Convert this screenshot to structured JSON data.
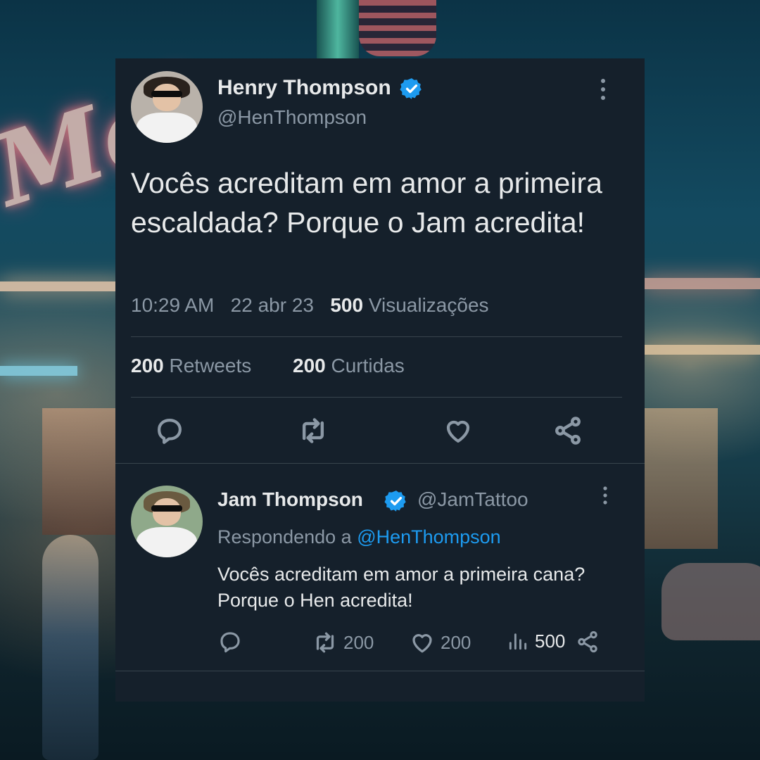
{
  "colors": {
    "card_bg": "#15202b",
    "text": "#e7e9ea",
    "muted": "#8b98a5",
    "link": "#1d9bf0",
    "divider": "#38444d"
  },
  "tweet": {
    "author_name": "Henry Thompson",
    "author_handle": "@HenThompson",
    "text": "Vocês acreditam em amor a primeira escaldada? Porque o Jam acredita!",
    "time": "10:29 AM",
    "date": "22 abr 23",
    "views_count": "500",
    "views_label": "Visualizações",
    "retweets_count": "200",
    "retweets_label": "Retweets",
    "likes_count": "200",
    "likes_label": "Curtidas",
    "icons": [
      "avatar",
      "verified-badge-icon",
      "more-options-icon",
      "reply-icon",
      "retweet-icon",
      "like-icon",
      "share-icon"
    ]
  },
  "reply": {
    "author_name": "Jam Thompson",
    "author_handle": "@JamTattoo",
    "replying_prefix": "Respondendo a",
    "replying_to": "@HenThompson",
    "text": "Vocês acreditam em amor a primeira cana? Porque o Hen acredita!",
    "retweets": "200",
    "likes": "200",
    "views": "500",
    "icons": [
      "reply-icon",
      "retweet-icon",
      "like-icon",
      "views-icon",
      "share-icon"
    ]
  }
}
